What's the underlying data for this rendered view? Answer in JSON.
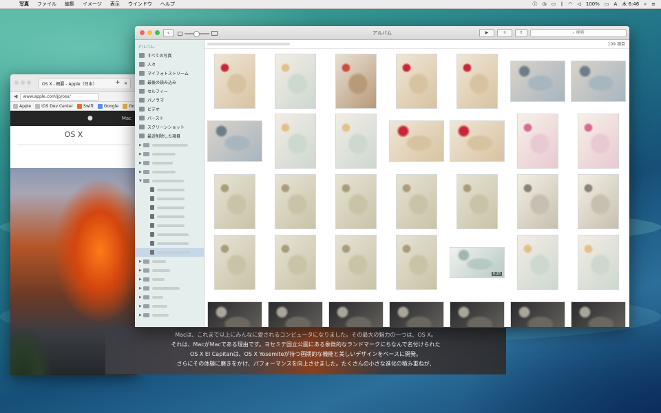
{
  "menubar": {
    "app_name": "写真",
    "items": [
      "ファイル",
      "編集",
      "イメージ",
      "表示",
      "ウインドウ",
      "ヘルプ"
    ],
    "battery": "100%",
    "clock": "木 6:46"
  },
  "safari": {
    "tab_title": "OS X - 概要 - Apple（日本）",
    "url": "www.apple.com/jp/osx/",
    "bookmarks": [
      "Apple",
      "iOS Dev Center",
      "Swift",
      "Google",
      "Go"
    ],
    "nav_item": "Mac",
    "page_heading": "OS X"
  },
  "page_text": [
    "Macは、これまで以上にみんなに愛されるコンピュータになりました。その最大の魅力の一つは、OS X。",
    "それは、MacがMacである理由です。ヨセミテ国立公園にある象徴的なランドマークにちなんで名付けられた",
    "OS X El Capitanは、OS X Yosemiteが持つ画期的な機能と美しいデザインをベースに開発。",
    "さらにその体験に磨きをかけ、パフォーマンスを向上させました。たくさんの小さな進化の積み重ねが、"
  ],
  "photos_window": {
    "title": "アルバム",
    "search_placeholder": "検索",
    "play_glyph": "▶",
    "add_glyph": "+",
    "share_glyph": "⇧",
    "item_count": "109 項目",
    "zoom_level": 0.45
  },
  "sidebar": {
    "header": "アルバム",
    "albums": [
      "すべての写真",
      "人々",
      "マイフォトストリーム",
      "最後の読み込み",
      "セルフィー",
      "パノラマ",
      "ビデオ",
      "バースト",
      "スクリーンショット",
      "最近削除した項目"
    ]
  },
  "video_duration": "0:26",
  "colors": {
    "accent_red": "#fc605c",
    "accent_yellow": "#fdbc40",
    "accent_green": "#34c84a",
    "sidebar_bg": "#e4efed"
  }
}
